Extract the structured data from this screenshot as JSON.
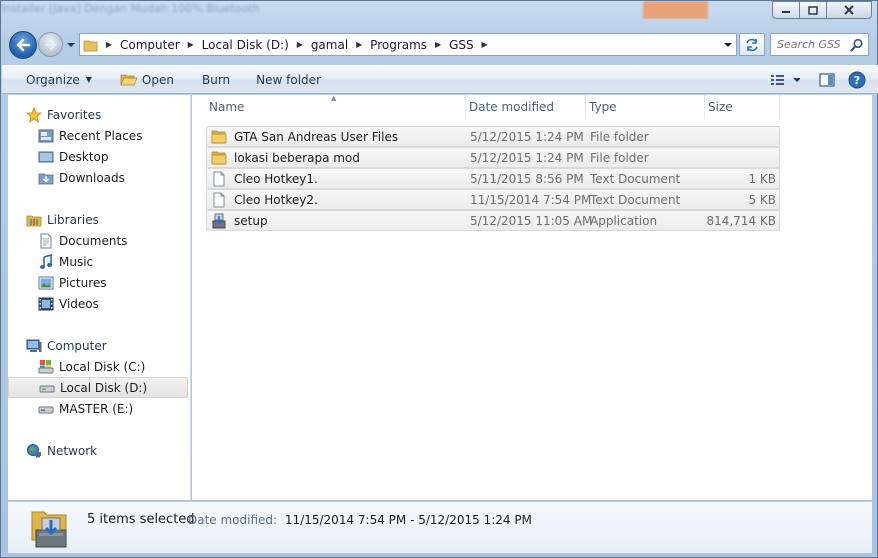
{
  "window": {
    "behind_title_text": "Installer [Java] Dengan Mudah 100% Bluetooth"
  },
  "address": {
    "breadcrumb": [
      "Computer",
      "Local Disk (D:)",
      "gamal",
      "Programs",
      "GSS"
    ],
    "search_placeholder": "Search GSS"
  },
  "toolbar": {
    "organize": "Organize",
    "open": "Open",
    "burn": "Burn",
    "new_folder": "New folder"
  },
  "nav": {
    "favorites": {
      "label": "Favorites",
      "items": [
        "Recent Places",
        "Desktop",
        "Downloads"
      ]
    },
    "libraries": {
      "label": "Libraries",
      "items": [
        "Documents",
        "Music",
        "Pictures",
        "Videos"
      ]
    },
    "computer": {
      "label": "Computer",
      "items": [
        "Local Disk (C:)",
        "Local Disk (D:)",
        "MASTER (E:)"
      ],
      "selected": "Local Disk (D:)"
    },
    "network": {
      "label": "Network"
    }
  },
  "columns": {
    "name": "Name",
    "date_modified": "Date modified",
    "type": "Type",
    "size": "Size"
  },
  "files": [
    {
      "name": "GTA San Andreas User Files",
      "date": "5/12/2015 1:24 PM",
      "type": "File folder",
      "size": "",
      "icon": "folder-icon"
    },
    {
      "name": "lokasi beberapa mod",
      "date": "5/12/2015 1:24 PM",
      "type": "File folder",
      "size": "",
      "icon": "folder-icon"
    },
    {
      "name": "Cleo Hotkey1.",
      "date": "5/11/2015 8:56 PM",
      "type": "Text Document",
      "size": "1 KB",
      "icon": "text-file-icon"
    },
    {
      "name": "Cleo Hotkey2.",
      "date": "11/15/2014 7:54 PM",
      "type": "Text Document",
      "size": "5 KB",
      "icon": "text-file-icon"
    },
    {
      "name": "setup",
      "date": "5/12/2015 11:05 AM",
      "type": "Application",
      "size": "814,714 KB",
      "icon": "installer-icon"
    }
  ],
  "details": {
    "count": "5 items selected",
    "date_label": "Date modified:",
    "date_value": "11/15/2014 7:54 PM - 5/12/2015 1:24 PM"
  },
  "colors": {
    "accent": "#1e395b",
    "folder": "#e8c25a",
    "selection": "#ececec"
  }
}
